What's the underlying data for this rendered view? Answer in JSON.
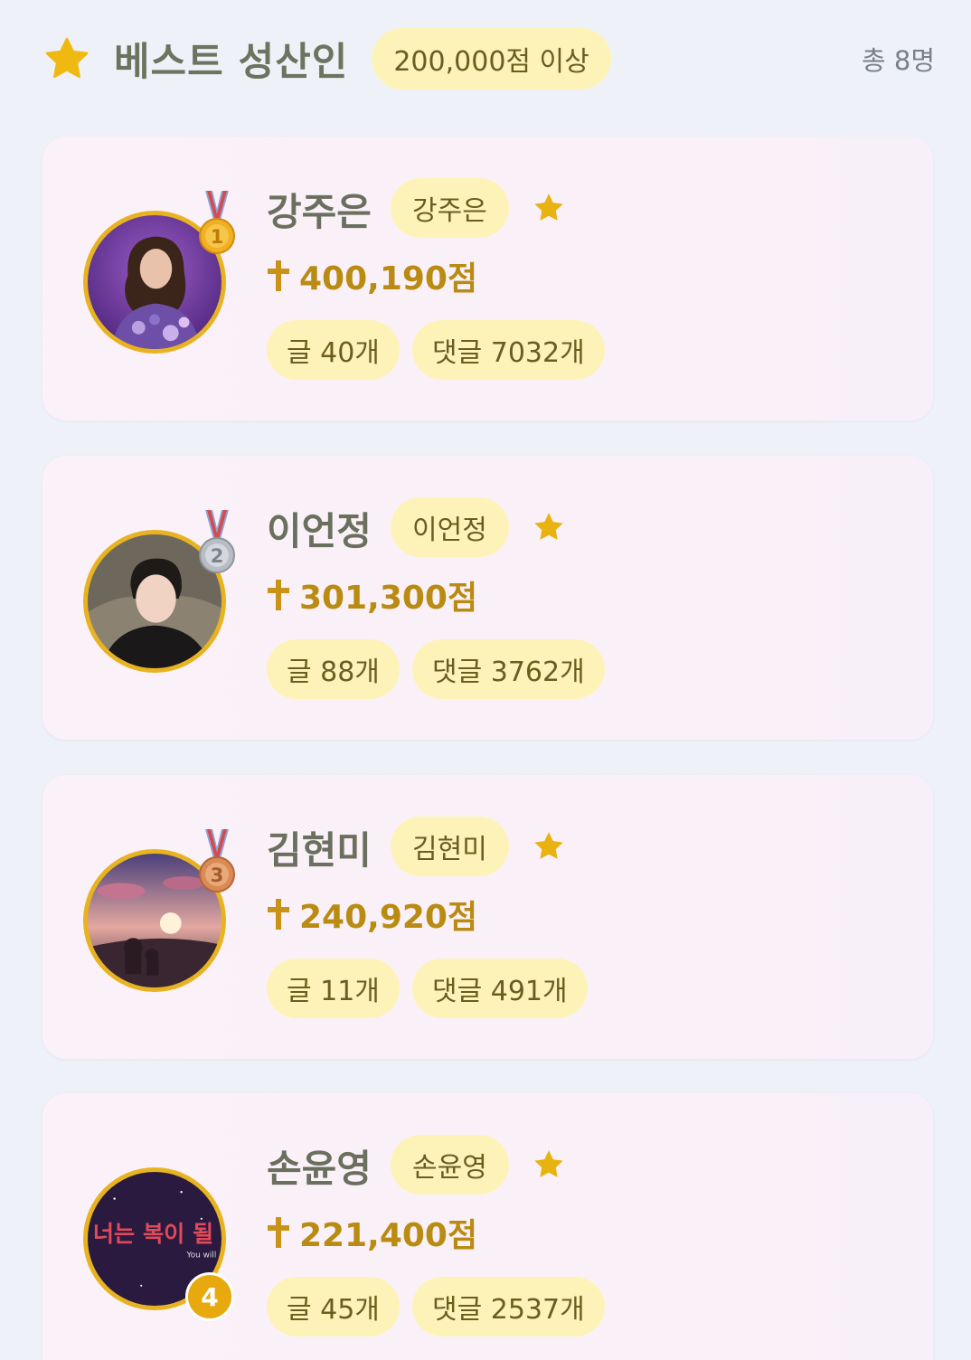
{
  "header": {
    "title": "베스트 성산인",
    "threshold": "200,000점 이상",
    "total": "총 8명",
    "accent": "#e8b320"
  },
  "members": [
    {
      "rank": "1",
      "medal": "gold",
      "name": "강주은",
      "nickname": "강주은",
      "score": "400,190점",
      "posts": "글 40개",
      "comments": "댓글 7032개"
    },
    {
      "rank": "2",
      "medal": "silver",
      "name": "이언정",
      "nickname": "이언정",
      "score": "301,300점",
      "posts": "글 88개",
      "comments": "댓글 3762개"
    },
    {
      "rank": "3",
      "medal": "bronze",
      "name": "김현미",
      "nickname": "김현미",
      "score": "240,920점",
      "posts": "글 11개",
      "comments": "댓글 491개"
    },
    {
      "rank": "4",
      "medal": "none",
      "name": "손윤영",
      "nickname": "손윤영",
      "score": "221,400점",
      "posts": "글 45개",
      "comments": "댓글 2537개",
      "avatar_text": "너는 복이 될",
      "avatar_subtext": "You will"
    }
  ]
}
